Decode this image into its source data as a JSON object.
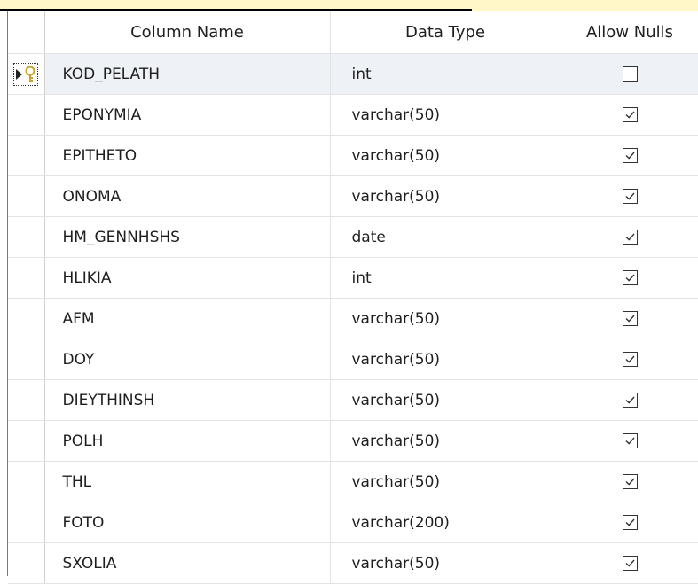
{
  "header_strip": {
    "highlight_color": "#fff7c8"
  },
  "columns": {
    "selector": "",
    "name": "Column Name",
    "type": "Data Type",
    "nulls": "Allow Nulls"
  },
  "rows": [
    {
      "name": "KOD_PELATH",
      "type": "int",
      "allow_nulls": false
    },
    {
      "name": "EPONYMIA",
      "type": "varchar(50)",
      "allow_nulls": true
    },
    {
      "name": "EPITHETO",
      "type": "varchar(50)",
      "allow_nulls": true
    },
    {
      "name": "ONOMA",
      "type": "varchar(50)",
      "allow_nulls": true
    },
    {
      "name": "HM_GENNHSHS",
      "type": "date",
      "allow_nulls": true
    },
    {
      "name": "HLIKIA",
      "type": "int",
      "allow_nulls": true
    },
    {
      "name": "AFM",
      "type": "varchar(50)",
      "allow_nulls": true
    },
    {
      "name": "DOY",
      "type": "varchar(50)",
      "allow_nulls": true
    },
    {
      "name": "DIEYTHINSH",
      "type": "varchar(50)",
      "allow_nulls": true
    },
    {
      "name": "POLH",
      "type": "varchar(50)",
      "allow_nulls": true
    },
    {
      "name": "THL",
      "type": "varchar(50)",
      "allow_nulls": true
    },
    {
      "name": "FOTO",
      "type": "varchar(200)",
      "allow_nulls": true
    },
    {
      "name": "SXOLIA",
      "type": "varchar(50)",
      "allow_nulls": true
    }
  ],
  "selected_row": 0,
  "primary_key_row": 0,
  "icons": {
    "row_selector": "current-row-arrow-icon",
    "primary_key": "primary-key-icon",
    "checked": "checkbox-checked-icon",
    "unchecked": "checkbox-unchecked-icon"
  },
  "colors": {
    "selected_row_bg": "#eef2f7",
    "key_icon": "#c9a227",
    "grid_line": "#e3e3e3",
    "check_stroke": "#333333"
  }
}
